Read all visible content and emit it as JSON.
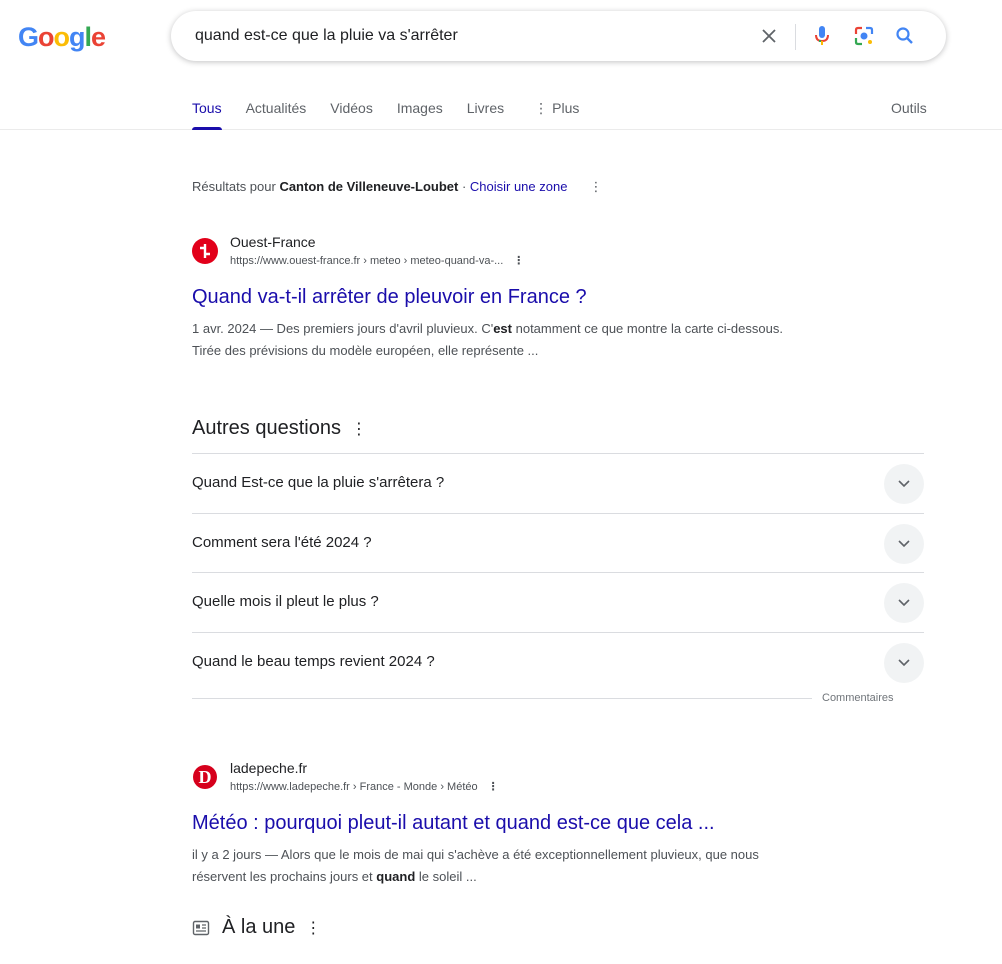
{
  "header": {
    "logo": [
      "G",
      "o",
      "o",
      "g",
      "l",
      "e"
    ],
    "search": {
      "value": "quand est-ce que la pluie va s'arrêter"
    },
    "tabs": [
      {
        "label": "Tous"
      },
      {
        "label": "Actualités"
      },
      {
        "label": "Vidéos"
      },
      {
        "label": "Images"
      },
      {
        "label": "Livres"
      },
      {
        "label": "Plus"
      }
    ],
    "tools": "Outils"
  },
  "location": {
    "prefix": "Résultats pour ",
    "place": "Canton de Villeneuve-Loubet",
    "sep": " · ",
    "choose": "Choisir une zone"
  },
  "results": [
    {
      "site": "Ouest-France",
      "url": "https://www.ouest-france.fr › meteo › meteo-quand-va-...",
      "title": "Quand va-t-il arrêter de pleuvoir en France ?",
      "date": "1 avr. 2024",
      "snippet_a": " — Des premiers jours d'avril pluvieux. C'",
      "snippet_bold": "est",
      "snippet_b": " notamment ce que montre la carte ci-dessous. Tirée des prévisions du modèle européen, elle représente ...",
      "favicon_color": "#e2001a"
    },
    {
      "site": "ladepeche.fr",
      "url": "https://www.ladepeche.fr › France - Monde › Météo",
      "title": "Météo : pourquoi pleut-il autant et quand est-ce que cela ...",
      "date": "il y a 2 jours",
      "snippet_a": " — Alors que le mois de mai qui s'achève a été exceptionnellement pluvieux, que nous réservent les prochains jours et ",
      "snippet_bold": "quand",
      "snippet_b": " le soleil ...",
      "favicon_color": "#d6001c"
    }
  ],
  "paa": {
    "title": "Autres questions",
    "questions": [
      "Quand Est-ce que la pluie s'arrêtera ?",
      "Comment sera l'été 2024 ?",
      "Quelle mois il pleut le plus ?",
      "Quand le beau temps revient 2024 ?"
    ],
    "feedback": "Commentaires"
  },
  "top_stories": {
    "title": "À la une"
  }
}
